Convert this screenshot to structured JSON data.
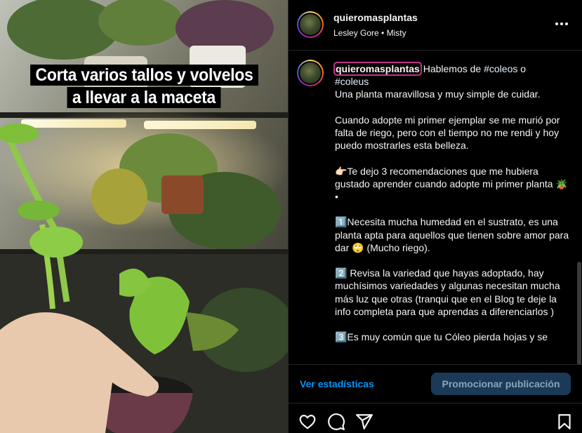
{
  "media": {
    "caption_line1": "Corta varios tallos y volvelos",
    "caption_line2": "a llevar a la maceta"
  },
  "header": {
    "username": "quieromasplantas",
    "audio": "Lesley Gore • Misty",
    "more_icon": "more-horizontal-icon"
  },
  "post": {
    "author": "quieromasplantas",
    "intro_text": " Hablemos de ",
    "tag1": "#coleos",
    "or_text": " o\n",
    "tag2": "#coleus",
    "body": "\nUna planta maravillosa y muy simple de cuidar.\n\nCuando adopte mi primer ejemplar se me murió por falta de riego, pero con el tiempo no me rendi y hoy puedo mostrarles esta belleza.\n\n👉🏻Te dejo 3 recomendaciones que me hubiera gustado aprender cuando adopte mi primer planta 🪴\n•\n\n1️⃣Necesita mucha humedad en el sustrato, es una planta apta para aquellos que tienen sobre amor para dar 🙄 (Mucho riego).\n\n2️⃣ Revisa la variedad que hayas adoptado, hay muchísimos variedades y algunas necesitan mucha más luz que otras (tranqui que en el Blog te deje la info completa para que aprendas a diferenciarlos )\n\n3️⃣Es muy común que tu Cóleo pierda hojas y se"
  },
  "actions": {
    "stats_label": "Ver estadísticas",
    "promote_label": "Promocionar publicación"
  },
  "icons": {
    "like": "heart-icon",
    "comment": "comment-icon",
    "share": "send-icon",
    "save": "bookmark-icon"
  },
  "colors": {
    "link_blue": "#0095f6",
    "promote_bg": "#1b3a57",
    "mention_outline": "#c13584"
  }
}
